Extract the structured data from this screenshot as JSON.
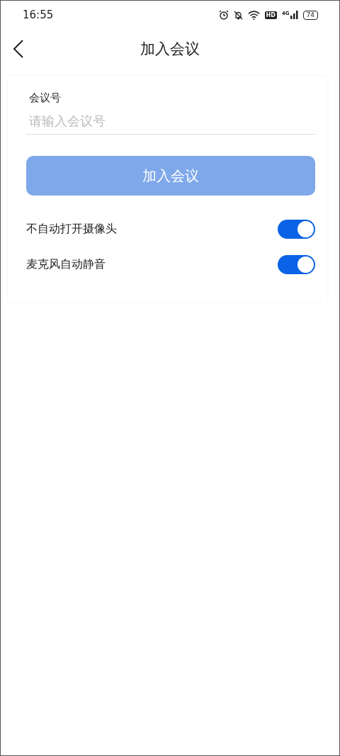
{
  "status_bar": {
    "time": "16:55",
    "hd": "HD",
    "network": "4G",
    "battery": "74"
  },
  "header": {
    "title": "加入会议"
  },
  "form": {
    "label": "会议号",
    "placeholder": "请输入会议号",
    "join_button": {
      "label": "加入会议",
      "disabled": true
    },
    "toggles": [
      {
        "label": "不自动打开摄像头",
        "on": true
      },
      {
        "label": "麦克风自动静音",
        "on": true
      }
    ]
  }
}
